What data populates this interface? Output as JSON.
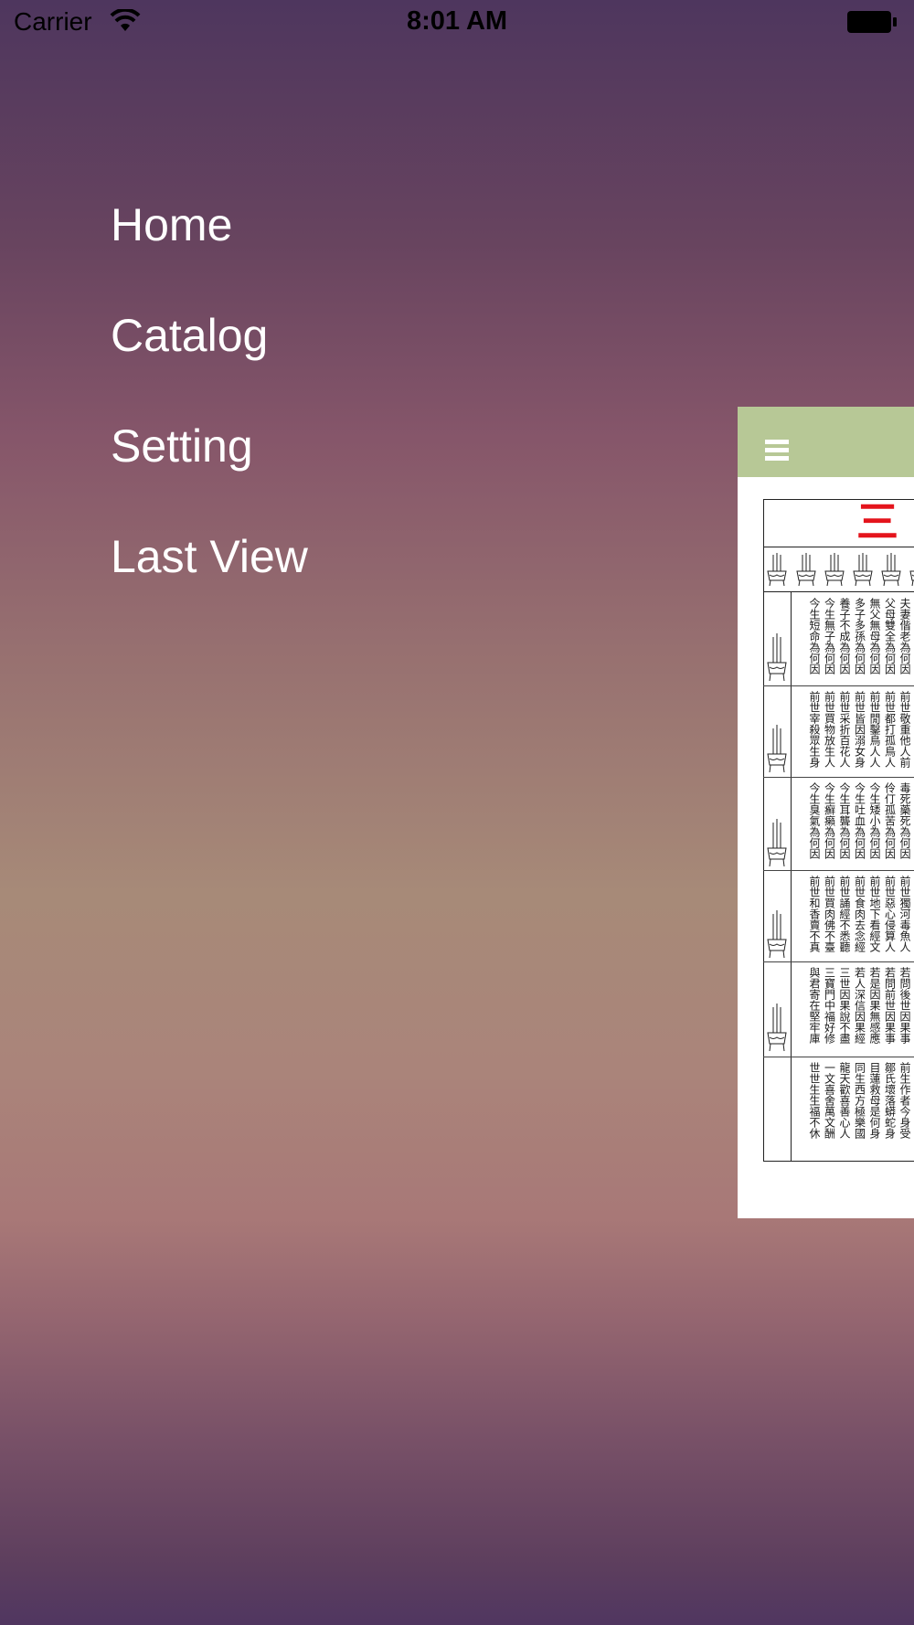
{
  "status_bar": {
    "carrier": "Carrier",
    "time": "8:01 AM",
    "wifi_icon": "wifi-icon",
    "battery_icon": "battery-icon"
  },
  "menu": {
    "items": [
      {
        "label": "Home"
      },
      {
        "label": "Catalog"
      },
      {
        "label": "Setting"
      },
      {
        "label": "Last View"
      }
    ]
  },
  "content": {
    "nav_icon": "hamburger-menu-icon",
    "nav_bar_color": "#b7c896",
    "page_title": "三",
    "blocks": [
      {
        "columns": [
          "今生短命為何因",
          "今生無子為何因",
          "養子不成為何因",
          "多子多孫為何因",
          "無父無母為何因",
          "父母雙全為何因",
          "夫妻偕老為何因"
        ]
      },
      {
        "columns": [
          "前世宰殺眾生身",
          "前世買物放生人",
          "前世采折百花人",
          "前世皆因溺女身",
          "前世閒鑿鳥人人",
          "前世都打孤鳥人",
          "前世敬重他人前"
        ]
      },
      {
        "columns": [
          "今生臭氣為何因",
          "今生癬癩為何因",
          "今生耳聾為何因",
          "今生吐血為何因",
          "今生矮小為何因",
          "伶仃孤苦為何因",
          "毒死藥死為何因"
        ]
      },
      {
        "columns": [
          "前世和香賣不真",
          "前世買肉佛不臺",
          "前世誦經不悉聽",
          "前世食肉去念經",
          "前世地下看經文",
          "前世惡心侵算人",
          "前世獨河毒魚人"
        ]
      },
      {
        "columns": [
          "與君寄在堅牢庫",
          "三寶門中福好修",
          "三世因果說不盡",
          "若人深信因果經",
          "若是因果無感應",
          "若問前世因果事",
          "若問後世因果事"
        ]
      },
      {
        "columns": [
          "世世生生福不休",
          "一文喜舍萬文酬",
          "龍天歡喜善心人",
          "同生西方極樂國",
          "目蓮救母是何身",
          "鄒氏壞落蟒蛇身",
          "前生作者今身受"
        ]
      }
    ]
  }
}
